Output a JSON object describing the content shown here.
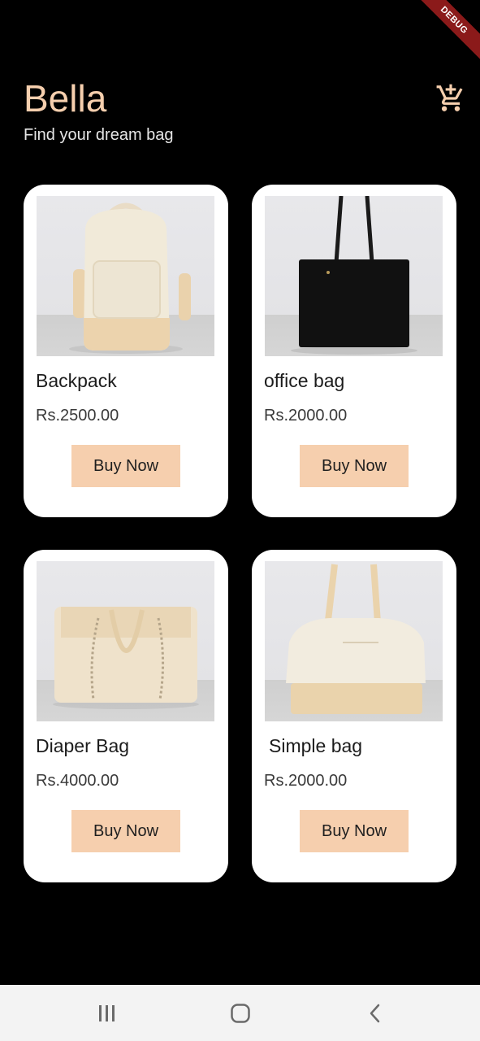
{
  "debug_banner": "DEBUG",
  "header": {
    "title": "Bella",
    "subtitle": "Find your dream bag",
    "cart_icon": "add-shopping-cart-icon"
  },
  "products": [
    {
      "name": "Backpack",
      "price": "Rs.2500.00",
      "button": "Buy Now",
      "image": "backpack-image"
    },
    {
      "name": "office bag",
      "price": "Rs.2000.00",
      "button": "Buy Now",
      "image": "office-bag-image"
    },
    {
      "name": "Diaper Bag",
      "price": "Rs.4000.00",
      "button": "Buy Now",
      "image": "diaper-bag-image"
    },
    {
      "name": "Simple bag",
      "price": "Rs.2000.00",
      "button": "Buy Now",
      "image": "simple-bag-image"
    }
  ],
  "nav": {
    "recents_icon": "recents-icon",
    "home_icon": "home-icon",
    "back_icon": "back-icon"
  },
  "colors": {
    "accent": "#f6cfae",
    "background": "#000000",
    "card": "#ffffff",
    "debug": "#8b1a1a"
  }
}
